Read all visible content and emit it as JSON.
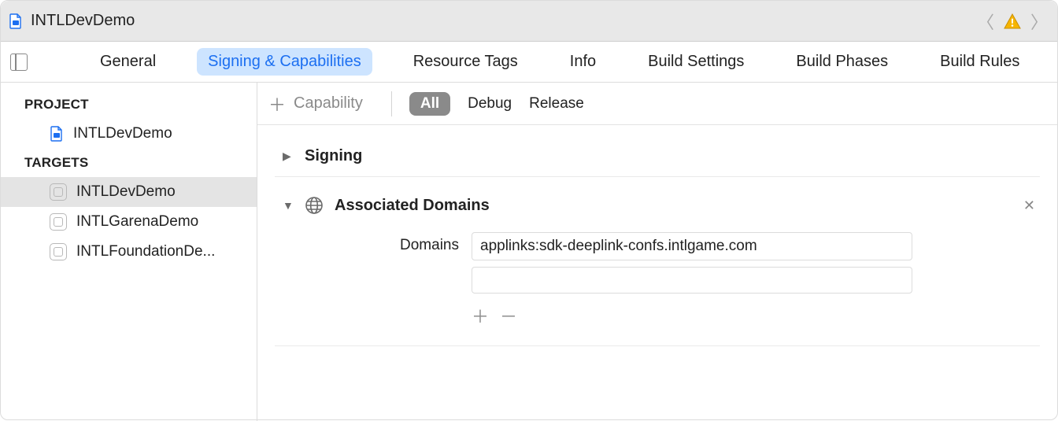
{
  "titlebar": {
    "project_name": "INTLDevDemo"
  },
  "tabs": {
    "items": [
      {
        "label": "General",
        "active": false
      },
      {
        "label": "Signing & Capabilities",
        "active": true
      },
      {
        "label": "Resource Tags",
        "active": false
      },
      {
        "label": "Info",
        "active": false
      },
      {
        "label": "Build Settings",
        "active": false
      },
      {
        "label": "Build Phases",
        "active": false
      },
      {
        "label": "Build Rules",
        "active": false
      }
    ]
  },
  "sidebar": {
    "project_header": "PROJECT",
    "project_name": "INTLDevDemo",
    "targets_header": "TARGETS",
    "targets": [
      {
        "name": "INTLDevDemo",
        "selected": true
      },
      {
        "name": "INTLGarenaDemo",
        "selected": false
      },
      {
        "name": "INTLFoundationDe...",
        "selected": false
      }
    ]
  },
  "capbar": {
    "add_label": "Capability",
    "segments": {
      "all": "All",
      "debug": "Debug",
      "release": "Release"
    }
  },
  "sections": {
    "signing": {
      "title": "Signing",
      "expanded": false
    },
    "associated_domains": {
      "title": "Associated Domains",
      "expanded": true,
      "domains_label": "Domains",
      "domains": [
        "applinks:sdk-deeplink-confs.intlgame.com"
      ]
    }
  }
}
